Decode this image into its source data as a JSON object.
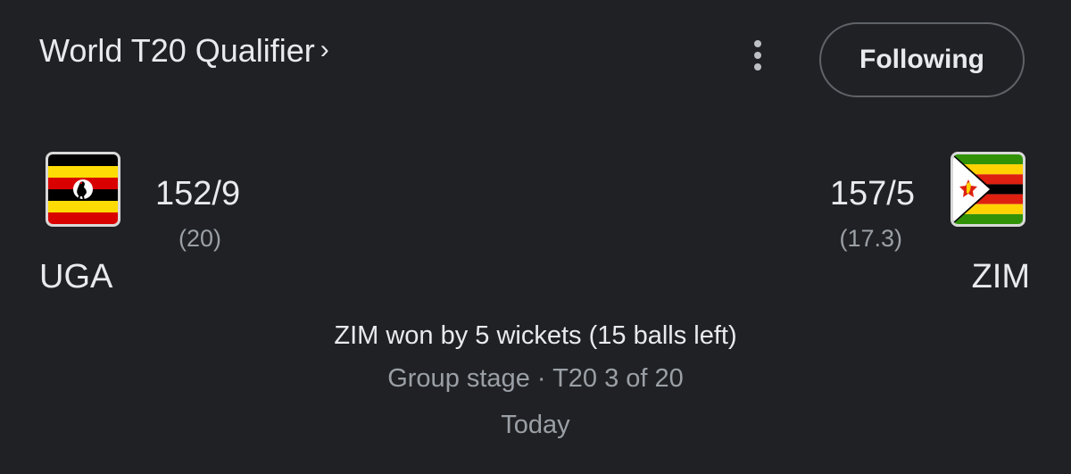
{
  "header": {
    "title": "World T20 Qualifier",
    "title_chevron": "›",
    "more_icon": "more-vert-icon",
    "follow_label": "Following"
  },
  "match": {
    "home": {
      "code": "UGA",
      "score": "152/9",
      "overs": "(20)",
      "flag_icon": "uganda-flag-icon"
    },
    "away": {
      "code": "ZIM",
      "score": "157/5",
      "overs": "(17.3)",
      "flag_icon": "zimbabwe-flag-icon"
    },
    "result": "ZIM won by 5 wickets (15 balls left)",
    "stage": "Group stage · T20 3 of 20",
    "date": "Today"
  },
  "colors": {
    "background": "#202124",
    "primary_text": "#e8eaed",
    "secondary_text": "#9aa0a6",
    "button_border": "#5f6368"
  }
}
